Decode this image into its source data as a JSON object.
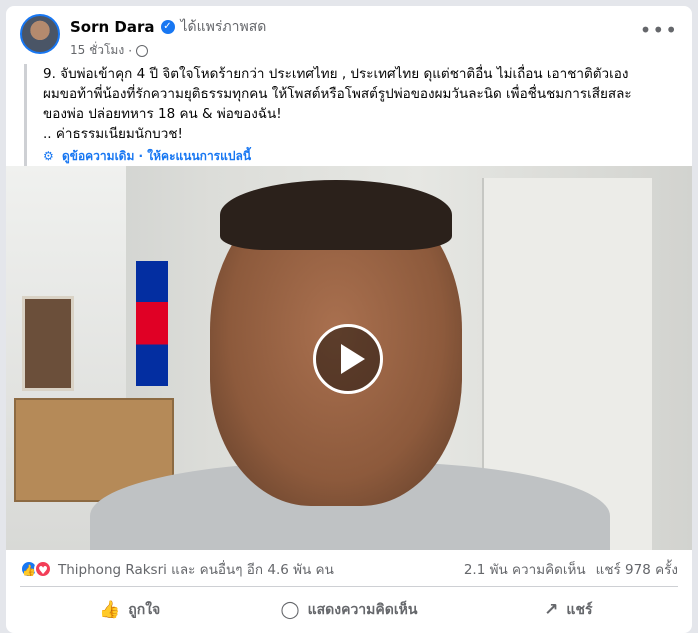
{
  "post": {
    "author": "Sorn Dara",
    "live_status": "ได้แพร่ภาพสด",
    "timestamp": "15 ชั่วโมง",
    "more": "•••",
    "text_lines": [
      "9. จับพ่อเข้าคุก 4 ปี จิตใจโหดร้ายกว่า ประเทศไทย , ประเทศไทย ดุแต่ชาติอื่น ไม่เถื่อน เอาชาติตัวเอง",
      "ผมขอท้าพี่น้องที่รักความยุติธรรมทุกคน ให้โพสต์หรือโพสต์รูปพ่อของผมวันละนิด เพื่อชื่นชมการเสียสละ",
      "ของพ่อ ปล่อยทหาร 18 คน & พ่อของฉัน!",
      ".. ค่าธรรมเนียมนักบวช!"
    ],
    "translation_link": "ดูข้อความเดิม · ให้คะแนนการแปลนี้"
  },
  "stats": {
    "reaction_text": "Thiphong Raksri และ คนอื่นๆ อีก 4.6 พัน คน",
    "comments": "2.1 พัน ความคิดเห็น",
    "shares": "แชร์ 978 ครั้ง"
  },
  "actions": {
    "like": "ถูกใจ",
    "comment": "แสดงความคิดเห็น",
    "share": "แชร์"
  },
  "icons": {
    "avatar": "avatar",
    "verified": "verified-badge-icon",
    "globe": "globe-icon",
    "play": "play-icon",
    "like": "thumbs-up-icon",
    "comment": "comment-icon",
    "share": "share-icon"
  },
  "colors": {
    "accent": "#1877f2",
    "love": "#f33e58",
    "secondary_text": "#65676b"
  }
}
